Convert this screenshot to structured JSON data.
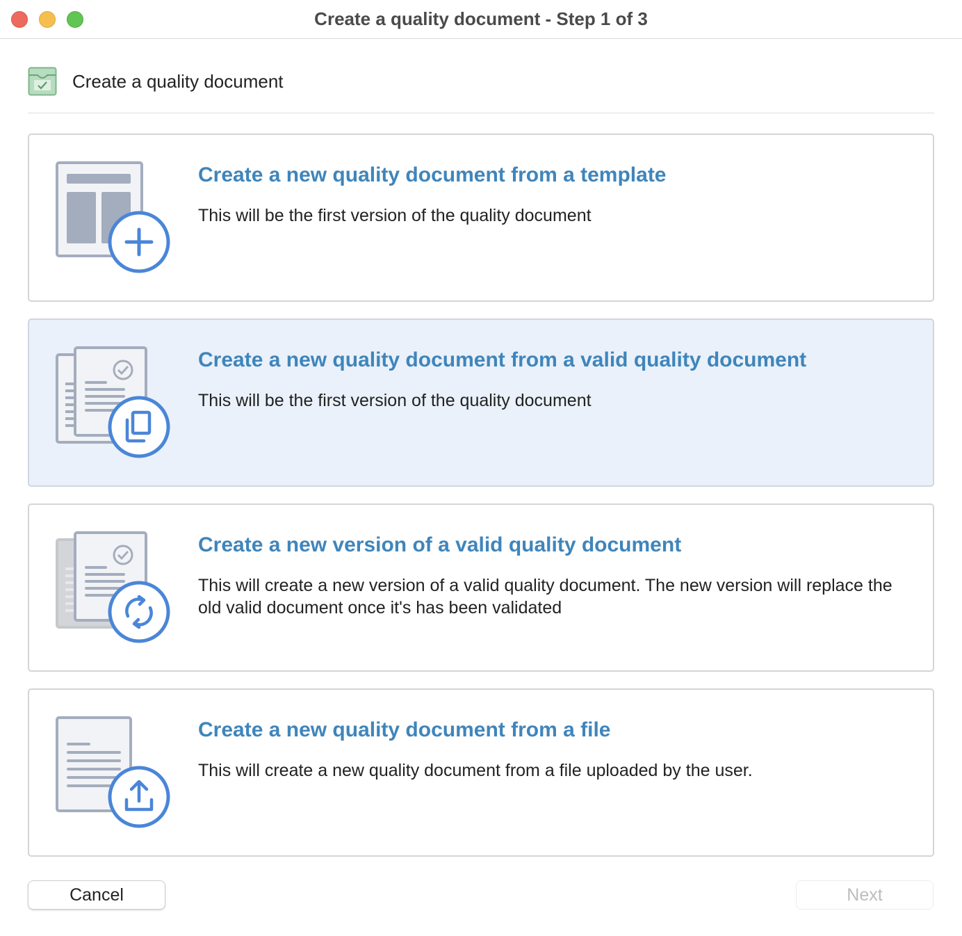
{
  "window": {
    "title": "Create a quality document - Step 1 of 3"
  },
  "header": {
    "title": "Create a quality document",
    "icon": "quality-document-icon"
  },
  "options": [
    {
      "title": "Create a new quality document from a template",
      "description": "This will be the first version of the quality document",
      "icon": "template-add-icon",
      "selected": false
    },
    {
      "title": "Create a new quality document from a valid quality document",
      "description": "This will be the first version of the quality document",
      "icon": "copy-document-icon",
      "selected": true
    },
    {
      "title": "Create a new version of a valid quality document",
      "description": "This will create a new version of a valid quality document. The new version will replace the old valid document once it's has been validated",
      "icon": "new-version-icon",
      "selected": false
    },
    {
      "title": "Create a new quality document from a file",
      "description": "This will create a new quality document from a file uploaded by the user.",
      "icon": "upload-file-icon",
      "selected": false
    }
  ],
  "buttons": {
    "cancel_label": "Cancel",
    "next_label": "Next",
    "next_enabled": false
  },
  "colors": {
    "accent": "#3f85bb",
    "icon_blue": "#4a86d8",
    "icon_gray": "#a3adbe",
    "selected_background": "#eaf1fa",
    "header_icon_green": "#8fc39a"
  }
}
